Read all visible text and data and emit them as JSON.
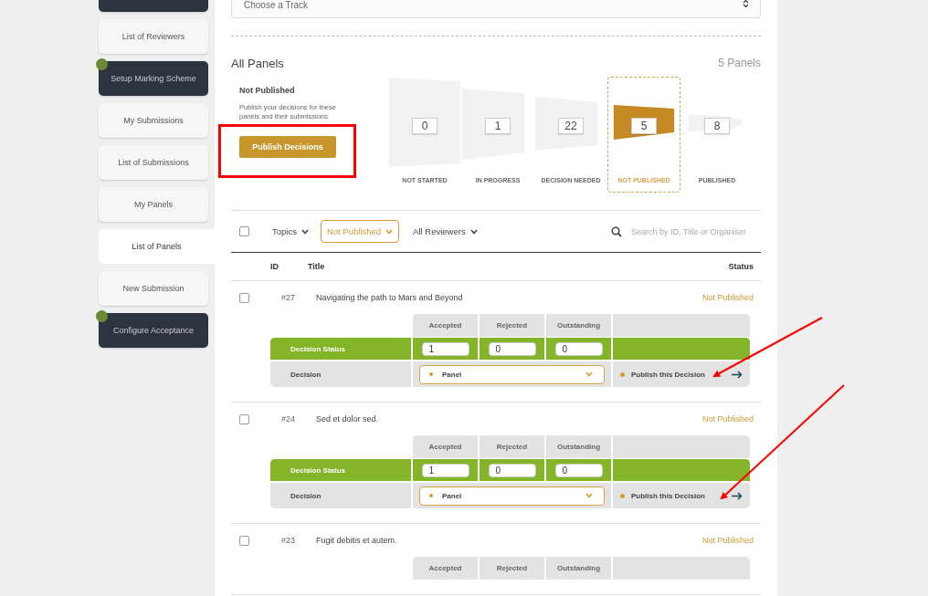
{
  "sidebar": {
    "items": [
      {
        "kind": "dark",
        "dot": false,
        "selected": false
      },
      {
        "label": "List of Reviewers",
        "kind": "light",
        "dot": false,
        "selected": false
      },
      {
        "label": "Setup Marking Scheme",
        "kind": "dark",
        "dot": true,
        "selected": false
      },
      {
        "label": "My Submissions",
        "kind": "light",
        "dot": false,
        "selected": false
      },
      {
        "label": "List of Submissions",
        "kind": "light",
        "dot": false,
        "selected": false
      },
      {
        "label": "My Panels",
        "kind": "light",
        "dot": false,
        "selected": false
      },
      {
        "label": "List of Panels",
        "kind": "light",
        "dot": false,
        "selected": true
      },
      {
        "label": "New Submission",
        "kind": "light",
        "dot": false,
        "selected": false
      },
      {
        "label": "Configure Acceptance",
        "kind": "dark",
        "dot": true,
        "selected": false
      }
    ]
  },
  "track_select": {
    "placeholder": "Choose a Track"
  },
  "summary": {
    "title": "All Panels",
    "count": "5 Panels",
    "subtitle": "Not Published",
    "description": "Publish your decisions for these panels and their submissions.",
    "button": "Publish Decisions"
  },
  "funnel": {
    "stages": [
      {
        "label": "NOT STARTED",
        "count": "0",
        "selected": false
      },
      {
        "label": "IN PROGRESS",
        "count": "1",
        "selected": false
      },
      {
        "label": "DECISION NEEDED",
        "count": "22",
        "selected": false
      },
      {
        "label": "NOT PUBLISHED",
        "count": "5",
        "selected": true
      },
      {
        "label": "PUBLISHED",
        "count": "8",
        "selected": false
      }
    ]
  },
  "filters": {
    "select_all_checked": false,
    "topics": "Topics",
    "status": "Not Published",
    "reviewers": "All Reviewers",
    "search_placeholder": "Search by ID, Title or Organiser"
  },
  "table": {
    "columns": [
      "ID",
      "Title",
      "Status"
    ],
    "rows": [
      {
        "checked": false,
        "id": "#27",
        "title": "Navigating the path to Mars and Beyond",
        "status": "Not Published",
        "decision": {
          "columns": [
            "Accepted",
            "Rejected",
            "Outstanding"
          ],
          "status_label": "Decision Status",
          "values": [
            "1",
            "0",
            "0"
          ],
          "decision_label": "Decision",
          "choice": "Panel",
          "action": "Publish this Decision"
        }
      },
      {
        "checked": false,
        "id": "#24",
        "title": "Sed et dolor sed.",
        "status": "Not Published",
        "decision": {
          "columns": [
            "Accepted",
            "Rejected",
            "Outstanding"
          ],
          "status_label": "Decision Status",
          "values": [
            "1",
            "0",
            "0"
          ],
          "decision_label": "Decision",
          "choice": "Panel",
          "action": "Publish this Decision"
        }
      },
      {
        "checked": false,
        "id": "#23",
        "title": "Fugit debitis et autem.",
        "status": "Not Published",
        "decision": {
          "columns": [
            "Accepted",
            "Rejected",
            "Outstanding"
          ]
        }
      }
    ]
  }
}
